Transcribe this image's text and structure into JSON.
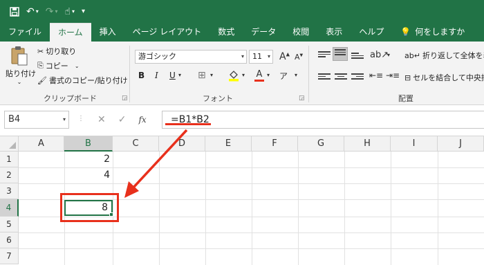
{
  "quick_access": {
    "save_icon": "save-icon",
    "undo_icon": "undo-icon",
    "redo_icon": "redo-icon",
    "touch_mode_icon": "touch-mode-icon",
    "customize_icon": "customize-icon"
  },
  "tabs": [
    {
      "label": "ファイル"
    },
    {
      "label": "ホーム"
    },
    {
      "label": "挿入"
    },
    {
      "label": "ページ レイアウト"
    },
    {
      "label": "数式"
    },
    {
      "label": "データ"
    },
    {
      "label": "校閲"
    },
    {
      "label": "表示"
    },
    {
      "label": "ヘルプ"
    },
    {
      "label": "何をしますか"
    }
  ],
  "ribbon": {
    "clipboard": {
      "paste_label": "貼り付け",
      "cut_label": "切り取り",
      "copy_label": "コピー",
      "format_painter_label": "書式のコピー/貼り付け",
      "group_label": "クリップボード"
    },
    "font": {
      "font_name": "游ゴシック",
      "font_size": "11",
      "grow_label": "A",
      "shrink_label": "A",
      "bold_label": "B",
      "italic_label": "I",
      "underline_label": "U",
      "font_color_label": "A",
      "phonetic_label": "ア",
      "group_label": "フォント"
    },
    "alignment": {
      "wrap_text_label": "折り返して全体を表示",
      "merge_center_label": "セルを結合して中央揃",
      "group_label": "配置"
    }
  },
  "formula_bar": {
    "name_box": "B4",
    "cancel_glyph": "✕",
    "enter_glyph": "✓",
    "fx_label": "fx",
    "formula": "=B1*B2"
  },
  "sheet": {
    "columns": [
      "A",
      "B",
      "C",
      "D",
      "E",
      "F",
      "G",
      "H",
      "I",
      "J"
    ],
    "rows": [
      "1",
      "2",
      "3",
      "4",
      "5",
      "6",
      "7"
    ],
    "cells": {
      "B1": "2",
      "B2": "4",
      "B4": "8"
    },
    "selected_column": "B",
    "selected_row": "4"
  },
  "colors": {
    "accent": "#217346",
    "annotation": "#e8301c"
  }
}
